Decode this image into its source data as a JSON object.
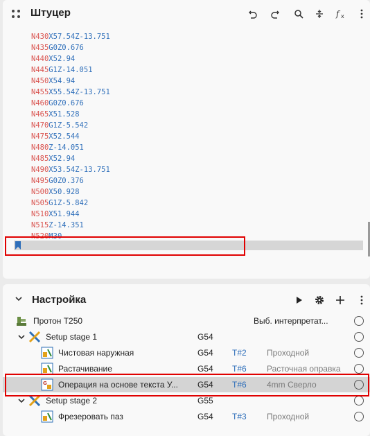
{
  "code_panel": {
    "title": "Штуцер",
    "icons": [
      "undo-icon",
      "redo-icon",
      "search-icon",
      "divide-icon",
      "function-icon",
      "more-vert-icon"
    ],
    "lines": [
      {
        "n": "N430",
        "rest": "X57.54Z-13.751"
      },
      {
        "n": "N435",
        "rest": "G0Z0.676"
      },
      {
        "n": "N440",
        "rest": "X52.94"
      },
      {
        "n": "N445",
        "rest": "G1Z-14.051"
      },
      {
        "n": "N450",
        "rest": "X54.94"
      },
      {
        "n": "N455",
        "rest": "X55.54Z-13.751"
      },
      {
        "n": "N460",
        "rest": "G0Z0.676"
      },
      {
        "n": "N465",
        "rest": "X51.528"
      },
      {
        "n": "N470",
        "rest": "G1Z-5.542"
      },
      {
        "n": "N475",
        "rest": "X52.544"
      },
      {
        "n": "N480",
        "rest": "Z-14.051"
      },
      {
        "n": "N485",
        "rest": "X52.94"
      },
      {
        "n": "N490",
        "rest": "X53.54Z-13.751"
      },
      {
        "n": "N495",
        "rest": "G0Z0.376"
      },
      {
        "n": "N500",
        "rest": "X50.928"
      },
      {
        "n": "N505",
        "rest": "G1Z-5.842"
      },
      {
        "n": "N510",
        "rest": "X51.944"
      },
      {
        "n": "N515",
        "rest": "Z-14.351"
      },
      {
        "n": "N520",
        "rest": "M30"
      }
    ]
  },
  "setup_panel": {
    "title": "Настройка",
    "icons": [
      "play-icon",
      "gear-icon",
      "plus-icon",
      "more-vert-icon"
    ],
    "machine": {
      "label": "Протон T250",
      "interpreter": "Выб. интерпретат..."
    },
    "stage1": {
      "label": "Setup stage 1",
      "wcs": "G54"
    },
    "ops": [
      {
        "label": "Чистовая наружная",
        "wcs": "G54",
        "tnum": "T#2",
        "tool": "Проходной"
      },
      {
        "label": "Растачивание",
        "wcs": "G54",
        "tnum": "T#6",
        "tool": "Расточная оправка"
      },
      {
        "label": "Операция на основе текста У...",
        "wcs": "G54",
        "tnum": "T#6",
        "tool": "4mm Сверло"
      }
    ],
    "stage2": {
      "label": "Setup stage 2",
      "wcs": "G55"
    },
    "ops2": [
      {
        "label": "Фрезеровать паз",
        "wcs": "G54",
        "tnum": "T#3",
        "tool": "Проходной"
      }
    ]
  },
  "colors": {
    "highlight": "#e00000",
    "code_number": "#d9534f",
    "code_text": "#2f6fba",
    "tool_number": "#2f6fba"
  }
}
